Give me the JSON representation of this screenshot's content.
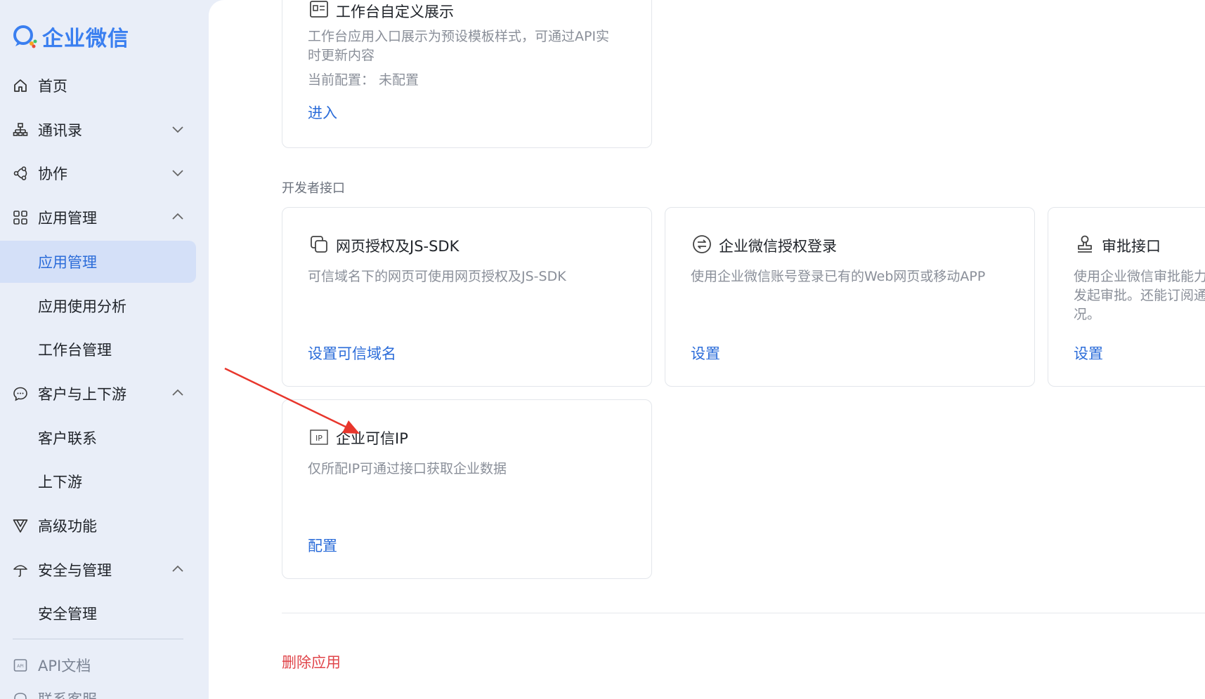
{
  "brand": {
    "name": "企业微信",
    "accent": "#3a7ff0"
  },
  "sidebar": {
    "items": [
      {
        "label": "首页",
        "icon": "home-icon"
      },
      {
        "label": "通讯录",
        "icon": "contacts-icon",
        "chevron": "down"
      },
      {
        "label": "协作",
        "icon": "collab-icon",
        "chevron": "down"
      },
      {
        "label": "应用管理",
        "icon": "apps-icon",
        "chevron": "up"
      },
      {
        "label": "应用管理",
        "sub": true,
        "active": true
      },
      {
        "label": "应用使用分析",
        "sub": true
      },
      {
        "label": "工作台管理",
        "sub": true
      },
      {
        "label": "客户与上下游",
        "icon": "chat-icon",
        "chevron": "up"
      },
      {
        "label": "客户联系",
        "sub": true
      },
      {
        "label": "上下游",
        "sub": true
      },
      {
        "label": "高级功能",
        "icon": "advanced-icon"
      },
      {
        "label": "安全与管理",
        "icon": "umbrella-icon",
        "chevron": "up"
      },
      {
        "label": "安全管理",
        "sub": true
      }
    ],
    "footer": [
      {
        "label": "API文档",
        "icon": "api-doc-icon"
      },
      {
        "label": "联系客服",
        "icon": "service-icon"
      }
    ]
  },
  "main": {
    "top_card": {
      "title": "工作台自定义展示",
      "desc_line1": "工作台应用入口展示为预设模板样式，可通过API实",
      "desc_line2": "时更新内容",
      "config": "当前配置：  未配置",
      "link": "进入"
    },
    "section_label": "开发者接口",
    "cards": [
      {
        "title": "网页授权及JS-SDK",
        "desc": "可信域名下的网页可使用网页授权及JS-SDK",
        "link": "设置可信域名",
        "icon": "web-auth-icon"
      },
      {
        "title": "企业微信授权登录",
        "desc": "使用企业微信账号登录已有的Web网页或移动APP",
        "link": "设置",
        "icon": "auth-login-icon"
      },
      {
        "title": "审批接口",
        "desc_line1": "使用企业微信审批能力",
        "desc_line2": "发起审批。还能订阅通",
        "desc_line3": "况。",
        "link": "设置",
        "icon": "approval-icon"
      },
      {
        "title": "企业可信IP",
        "desc": "仅所配IP可通过接口获取企业数据",
        "link": "配置",
        "icon": "ip-icon"
      }
    ],
    "delete_link": "删除应用",
    "colors": {
      "link": "#2b6cd9",
      "danger": "#e0454a",
      "annotation_arrow": "#e8362c"
    }
  }
}
